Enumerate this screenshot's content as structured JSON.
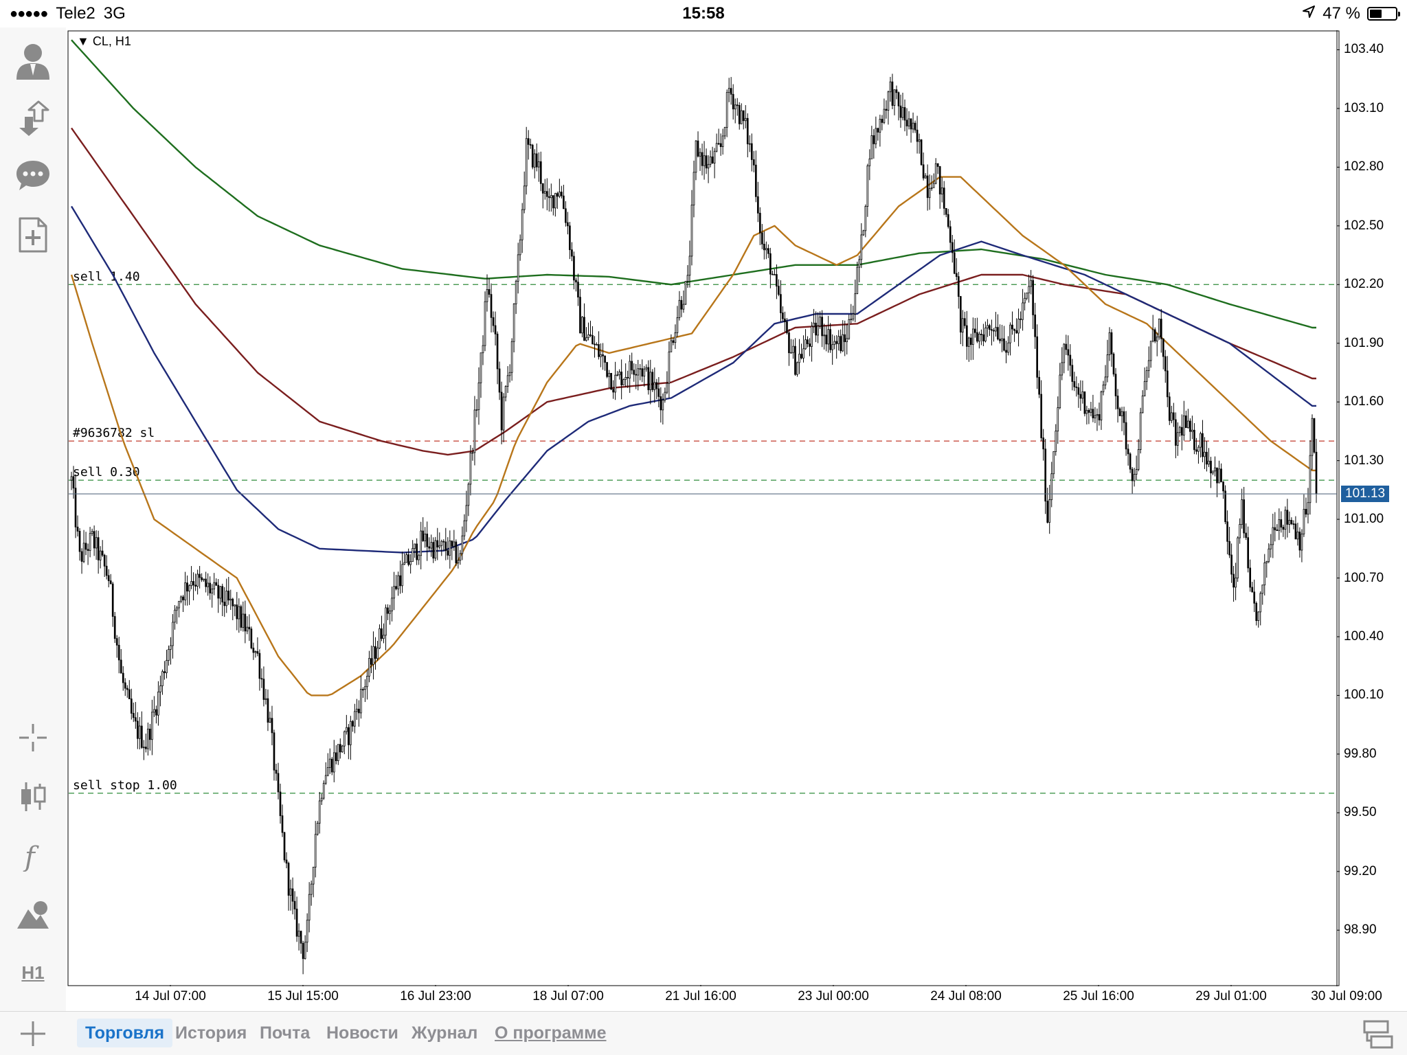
{
  "status_bar": {
    "carrier": "Tele2",
    "network": "3G",
    "time": "15:58",
    "battery": "47 %",
    "battery_level": 0.47
  },
  "sidebar": {
    "top_icons": [
      "account-icon",
      "trade-transfer-icon",
      "chat-icon",
      "new-document-icon"
    ],
    "bottom_icons": [
      "crosshair-icon",
      "chart-type-icon",
      "indicators-icon",
      "objects-icon"
    ],
    "timeframe": "H1"
  },
  "chart_header": {
    "symbol_label": "CL, H1"
  },
  "price_axis": {
    "labels": [
      "103.40",
      "103.10",
      "102.80",
      "102.50",
      "102.20",
      "101.90",
      "101.60",
      "101.30",
      "101.00",
      "100.70",
      "100.40",
      "100.10",
      "99.80",
      "99.50",
      "99.20",
      "98.90"
    ],
    "current_price": "101.13"
  },
  "time_axis": {
    "labels": [
      "14 Jul 07:00",
      "15 Jul 15:00",
      "16 Jul 23:00",
      "18 Jul 07:00",
      "21 Jul 16:00",
      "23 Jul 00:00",
      "24 Jul 08:00",
      "25 Jul 16:00",
      "29 Jul 01:00",
      "30 Jul 09:00"
    ]
  },
  "order_lines": [
    {
      "label": "sell 1.40",
      "price": 102.2,
      "color": "#2e8b3a"
    },
    {
      "label": "#9636782 sl",
      "price": 101.4,
      "color": "#c0392b"
    },
    {
      "label": "sell 0.30",
      "price": 101.2,
      "color": "#2e8b3a"
    },
    {
      "label": "sell stop 1.00",
      "price": 99.6,
      "color": "#2e8b3a"
    }
  ],
  "chart_data": {
    "type": "candlestick",
    "title": "CL, H1",
    "ylim": [
      98.62,
      103.5
    ],
    "current_price": 101.13,
    "colors": {
      "ma_fast": "#b8761a",
      "ma_mid": "#1e2a78",
      "ma_slow": "#7a1e1e",
      "ma_long": "#1e6e1e",
      "bid_line": "#5a6e82",
      "price_tag": "#1f5f9e"
    },
    "price_path": [
      [
        0,
        101.2
      ],
      [
        4,
        100.8
      ],
      [
        10,
        100.9
      ],
      [
        18,
        100.7
      ],
      [
        24,
        100.2
      ],
      [
        30,
        99.95
      ],
      [
        36,
        99.85
      ],
      [
        42,
        100.1
      ],
      [
        46,
        100.3
      ],
      [
        52,
        100.6
      ],
      [
        58,
        100.7
      ],
      [
        66,
        100.65
      ],
      [
        72,
        100.6
      ],
      [
        78,
        100.55
      ],
      [
        84,
        100.45
      ],
      [
        90,
        100.3
      ],
      [
        96,
        99.95
      ],
      [
        100,
        99.55
      ],
      [
        104,
        99.2
      ],
      [
        108,
        98.95
      ],
      [
        112,
        98.8
      ],
      [
        114,
        98.9
      ],
      [
        118,
        99.4
      ],
      [
        122,
        99.7
      ],
      [
        128,
        99.8
      ],
      [
        134,
        99.9
      ],
      [
        140,
        100.1
      ],
      [
        146,
        100.3
      ],
      [
        152,
        100.5
      ],
      [
        158,
        100.7
      ],
      [
        164,
        100.8
      ],
      [
        170,
        100.9
      ],
      [
        176,
        100.85
      ],
      [
        182,
        100.85
      ],
      [
        188,
        100.8
      ],
      [
        194,
        101.4
      ],
      [
        198,
        101.8
      ],
      [
        201,
        102.2
      ],
      [
        205,
        101.9
      ],
      [
        208,
        101.5
      ],
      [
        212,
        101.8
      ],
      [
        216,
        102.3
      ],
      [
        220,
        102.9
      ],
      [
        226,
        102.8
      ],
      [
        230,
        102.6
      ],
      [
        236,
        102.7
      ],
      [
        240,
        102.5
      ],
      [
        246,
        102.0
      ],
      [
        252,
        101.9
      ],
      [
        258,
        101.8
      ],
      [
        262,
        101.7
      ],
      [
        268,
        101.75
      ],
      [
        274,
        101.8
      ],
      [
        280,
        101.7
      ],
      [
        286,
        101.6
      ],
      [
        290,
        101.9
      ],
      [
        294,
        102.1
      ],
      [
        298,
        102.2
      ],
      [
        302,
        102.9
      ],
      [
        308,
        102.8
      ],
      [
        314,
        102.9
      ],
      [
        318,
        103.2
      ],
      [
        322,
        103.1
      ],
      [
        326,
        103.0
      ],
      [
        330,
        102.8
      ],
      [
        334,
        102.4
      ],
      [
        338,
        102.3
      ],
      [
        344,
        102.0
      ],
      [
        350,
        101.8
      ],
      [
        356,
        101.9
      ],
      [
        362,
        102.0
      ],
      [
        368,
        101.9
      ],
      [
        374,
        101.9
      ],
      [
        378,
        102.1
      ],
      [
        382,
        102.4
      ],
      [
        386,
        102.9
      ],
      [
        390,
        103.0
      ],
      [
        396,
        103.2
      ],
      [
        400,
        103.1
      ],
      [
        406,
        103.0
      ],
      [
        410,
        102.9
      ],
      [
        414,
        102.7
      ],
      [
        418,
        102.8
      ],
      [
        422,
        102.6
      ],
      [
        426,
        102.4
      ],
      [
        430,
        102.0
      ],
      [
        434,
        101.9
      ],
      [
        440,
        101.95
      ],
      [
        446,
        102.0
      ],
      [
        452,
        101.9
      ],
      [
        458,
        102.0
      ],
      [
        464,
        102.2
      ],
      [
        468,
        101.6
      ],
      [
        472,
        101.0
      ],
      [
        476,
        101.5
      ],
      [
        480,
        101.9
      ],
      [
        484,
        101.7
      ],
      [
        490,
        101.6
      ],
      [
        496,
        101.5
      ],
      [
        502,
        101.9
      ],
      [
        506,
        101.6
      ],
      [
        510,
        101.4
      ],
      [
        514,
        101.2
      ],
      [
        518,
        101.6
      ],
      [
        522,
        101.9
      ],
      [
        526,
        102.0
      ],
      [
        530,
        101.6
      ],
      [
        534,
        101.4
      ],
      [
        538,
        101.5
      ],
      [
        542,
        101.4
      ],
      [
        546,
        101.4
      ],
      [
        550,
        101.3
      ],
      [
        556,
        101.2
      ],
      [
        560,
        100.8
      ],
      [
        562,
        100.6
      ],
      [
        566,
        101.1
      ],
      [
        570,
        100.6
      ],
      [
        574,
        100.5
      ],
      [
        578,
        100.8
      ],
      [
        582,
        101.0
      ],
      [
        586,
        101.0
      ],
      [
        590,
        101.0
      ],
      [
        594,
        100.9
      ],
      [
        598,
        101.1
      ],
      [
        600,
        101.5
      ],
      [
        602,
        101.1
      ]
    ],
    "moving_averages": [
      {
        "name": "ma_long",
        "color": "#1e6e1e",
        "values": [
          [
            0,
            103.45
          ],
          [
            30,
            103.1
          ],
          [
            60,
            102.8
          ],
          [
            90,
            102.55
          ],
          [
            120,
            102.4
          ],
          [
            160,
            102.28
          ],
          [
            200,
            102.23
          ],
          [
            230,
            102.25
          ],
          [
            260,
            102.24
          ],
          [
            290,
            102.2
          ],
          [
            320,
            102.25
          ],
          [
            350,
            102.3
          ],
          [
            380,
            102.3
          ],
          [
            410,
            102.36
          ],
          [
            440,
            102.38
          ],
          [
            470,
            102.33
          ],
          [
            500,
            102.25
          ],
          [
            530,
            102.2
          ],
          [
            560,
            102.1
          ],
          [
            600,
            101.98
          ]
        ]
      },
      {
        "name": "ma_slow",
        "color": "#7a1e1e",
        "values": [
          [
            0,
            103.0
          ],
          [
            30,
            102.55
          ],
          [
            60,
            102.1
          ],
          [
            90,
            101.75
          ],
          [
            120,
            101.5
          ],
          [
            150,
            101.4
          ],
          [
            170,
            101.35
          ],
          [
            182,
            101.33
          ],
          [
            195,
            101.35
          ],
          [
            210,
            101.45
          ],
          [
            230,
            101.6
          ],
          [
            260,
            101.67
          ],
          [
            290,
            101.7
          ],
          [
            320,
            101.83
          ],
          [
            350,
            101.98
          ],
          [
            380,
            102.0
          ],
          [
            410,
            102.15
          ],
          [
            440,
            102.25
          ],
          [
            460,
            102.25
          ],
          [
            480,
            102.2
          ],
          [
            510,
            102.15
          ],
          [
            530,
            102.05
          ],
          [
            560,
            101.9
          ],
          [
            600,
            101.72
          ]
        ]
      },
      {
        "name": "ma_mid",
        "color": "#1e2a78",
        "values": [
          [
            0,
            102.6
          ],
          [
            20,
            102.25
          ],
          [
            40,
            101.85
          ],
          [
            60,
            101.5
          ],
          [
            80,
            101.15
          ],
          [
            100,
            100.95
          ],
          [
            120,
            100.85
          ],
          [
            140,
            100.84
          ],
          [
            160,
            100.83
          ],
          [
            180,
            100.84
          ],
          [
            195,
            100.9
          ],
          [
            210,
            101.1
          ],
          [
            230,
            101.35
          ],
          [
            250,
            101.5
          ],
          [
            270,
            101.58
          ],
          [
            290,
            101.62
          ],
          [
            320,
            101.8
          ],
          [
            340,
            102.0
          ],
          [
            360,
            102.05
          ],
          [
            380,
            102.05
          ],
          [
            400,
            102.2
          ],
          [
            420,
            102.35
          ],
          [
            440,
            102.42
          ],
          [
            460,
            102.35
          ],
          [
            490,
            102.25
          ],
          [
            510,
            102.15
          ],
          [
            530,
            102.05
          ],
          [
            560,
            101.9
          ],
          [
            600,
            101.58
          ]
        ]
      },
      {
        "name": "ma_fast",
        "color": "#b8761a",
        "values": [
          [
            0,
            102.25
          ],
          [
            10,
            101.9
          ],
          [
            25,
            101.4
          ],
          [
            40,
            101.0
          ],
          [
            60,
            100.85
          ],
          [
            80,
            100.7
          ],
          [
            100,
            100.3
          ],
          [
            115,
            100.1
          ],
          [
            125,
            100.1
          ],
          [
            140,
            100.2
          ],
          [
            155,
            100.35
          ],
          [
            170,
            100.55
          ],
          [
            185,
            100.75
          ],
          [
            195,
            100.95
          ],
          [
            205,
            101.1
          ],
          [
            215,
            101.4
          ],
          [
            230,
            101.7
          ],
          [
            245,
            101.9
          ],
          [
            260,
            101.85
          ],
          [
            280,
            101.9
          ],
          [
            300,
            101.95
          ],
          [
            310,
            102.1
          ],
          [
            320,
            102.25
          ],
          [
            330,
            102.45
          ],
          [
            340,
            102.5
          ],
          [
            350,
            102.4
          ],
          [
            370,
            102.3
          ],
          [
            380,
            102.35
          ],
          [
            400,
            102.6
          ],
          [
            420,
            102.75
          ],
          [
            430,
            102.75
          ],
          [
            440,
            102.65
          ],
          [
            460,
            102.45
          ],
          [
            480,
            102.3
          ],
          [
            500,
            102.1
          ],
          [
            520,
            102.0
          ],
          [
            540,
            101.8
          ],
          [
            560,
            101.6
          ],
          [
            580,
            101.4
          ],
          [
            600,
            101.25
          ]
        ]
      }
    ]
  }
}
